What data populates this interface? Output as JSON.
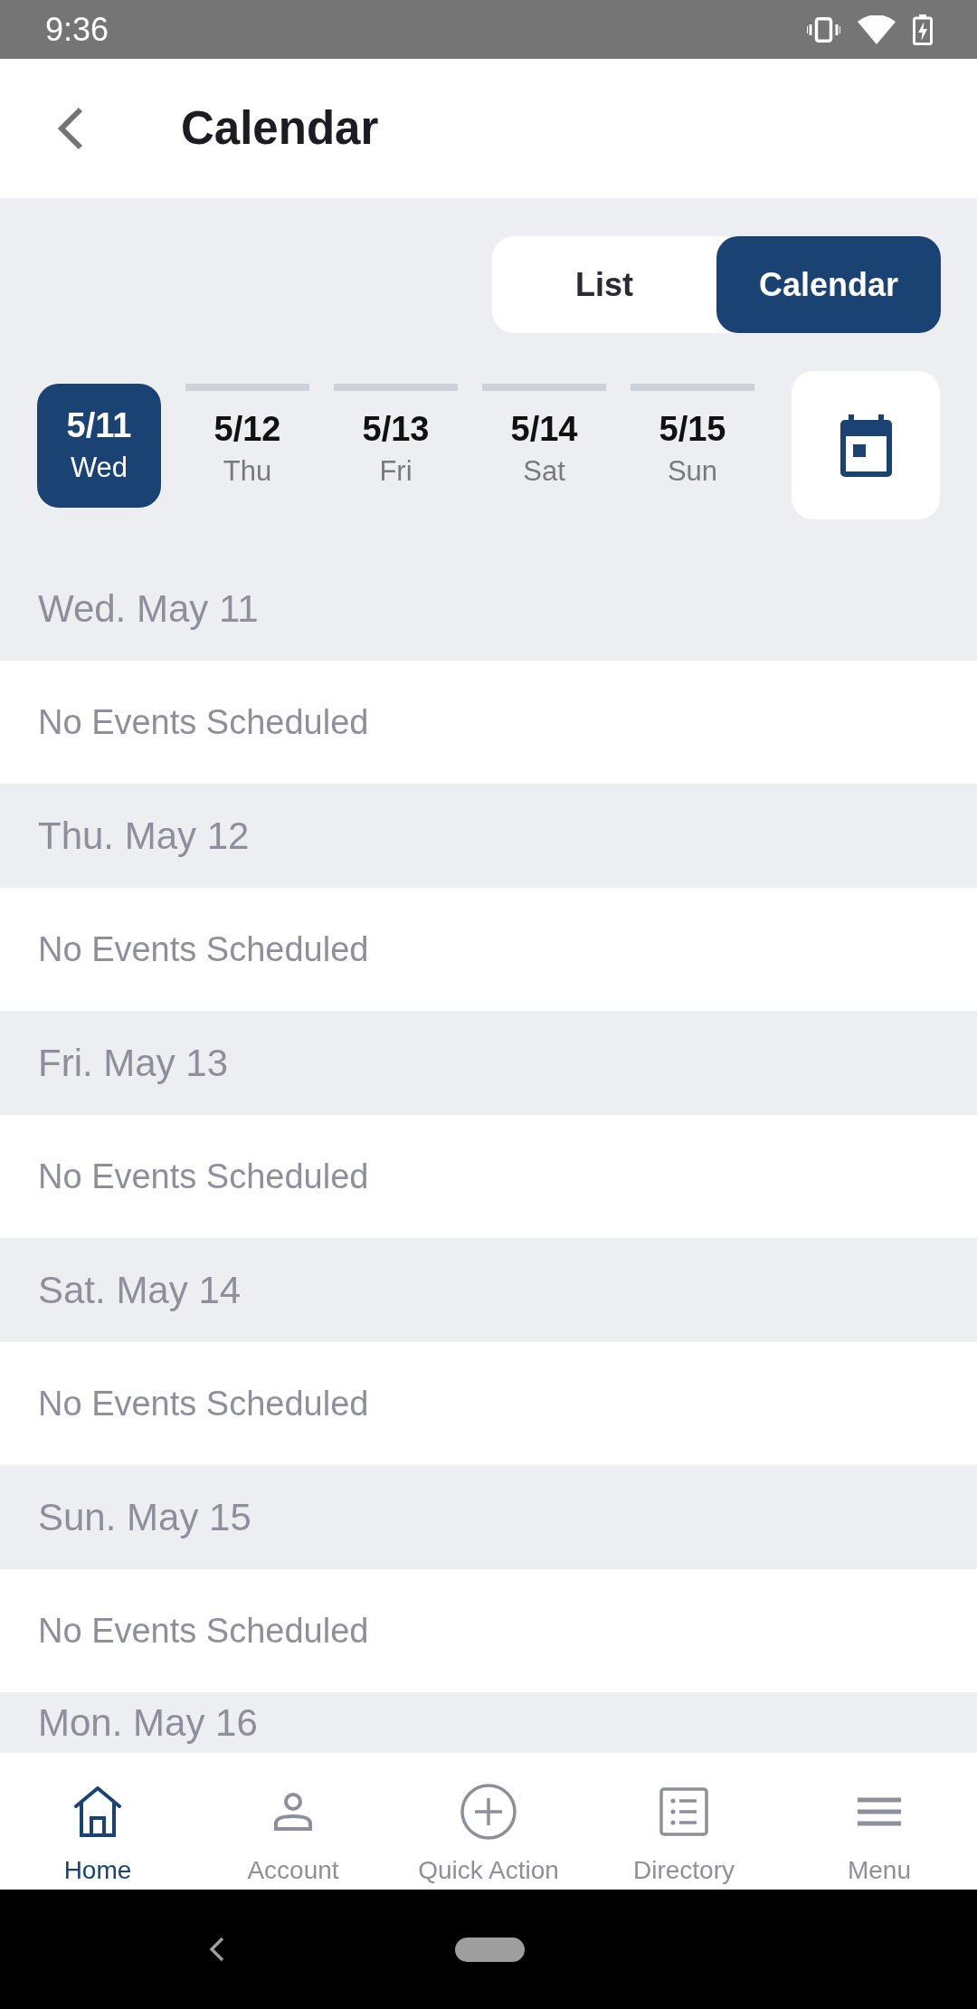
{
  "status_bar": {
    "time": "9:36"
  },
  "header": {
    "title": "Calendar"
  },
  "view_toggle": [
    {
      "label": "List",
      "selected": false
    },
    {
      "label": "Calendar",
      "selected": true
    }
  ],
  "date_strip": [
    {
      "date": "5/11",
      "weekday": "Wed",
      "selected": true
    },
    {
      "date": "5/12",
      "weekday": "Thu",
      "selected": false
    },
    {
      "date": "5/13",
      "weekday": "Fri",
      "selected": false
    },
    {
      "date": "5/14",
      "weekday": "Sat",
      "selected": false
    },
    {
      "date": "5/15",
      "weekday": "Sun",
      "selected": false
    }
  ],
  "agenda": [
    {
      "heading": "Wed. May 11",
      "message": "No Events Scheduled"
    },
    {
      "heading": "Thu. May 12",
      "message": "No Events Scheduled"
    },
    {
      "heading": "Fri. May 13",
      "message": "No Events Scheduled"
    },
    {
      "heading": "Sat. May 14",
      "message": "No Events Scheduled"
    },
    {
      "heading": "Sun. May 15",
      "message": "No Events Scheduled"
    },
    {
      "heading": "Mon. May 16"
    }
  ],
  "bottom_nav": [
    {
      "label": "Home",
      "selected": true
    },
    {
      "label": "Account",
      "selected": false
    },
    {
      "label": "Quick Action",
      "selected": false
    },
    {
      "label": "Directory",
      "selected": false
    },
    {
      "label": "Menu",
      "selected": false
    }
  ]
}
